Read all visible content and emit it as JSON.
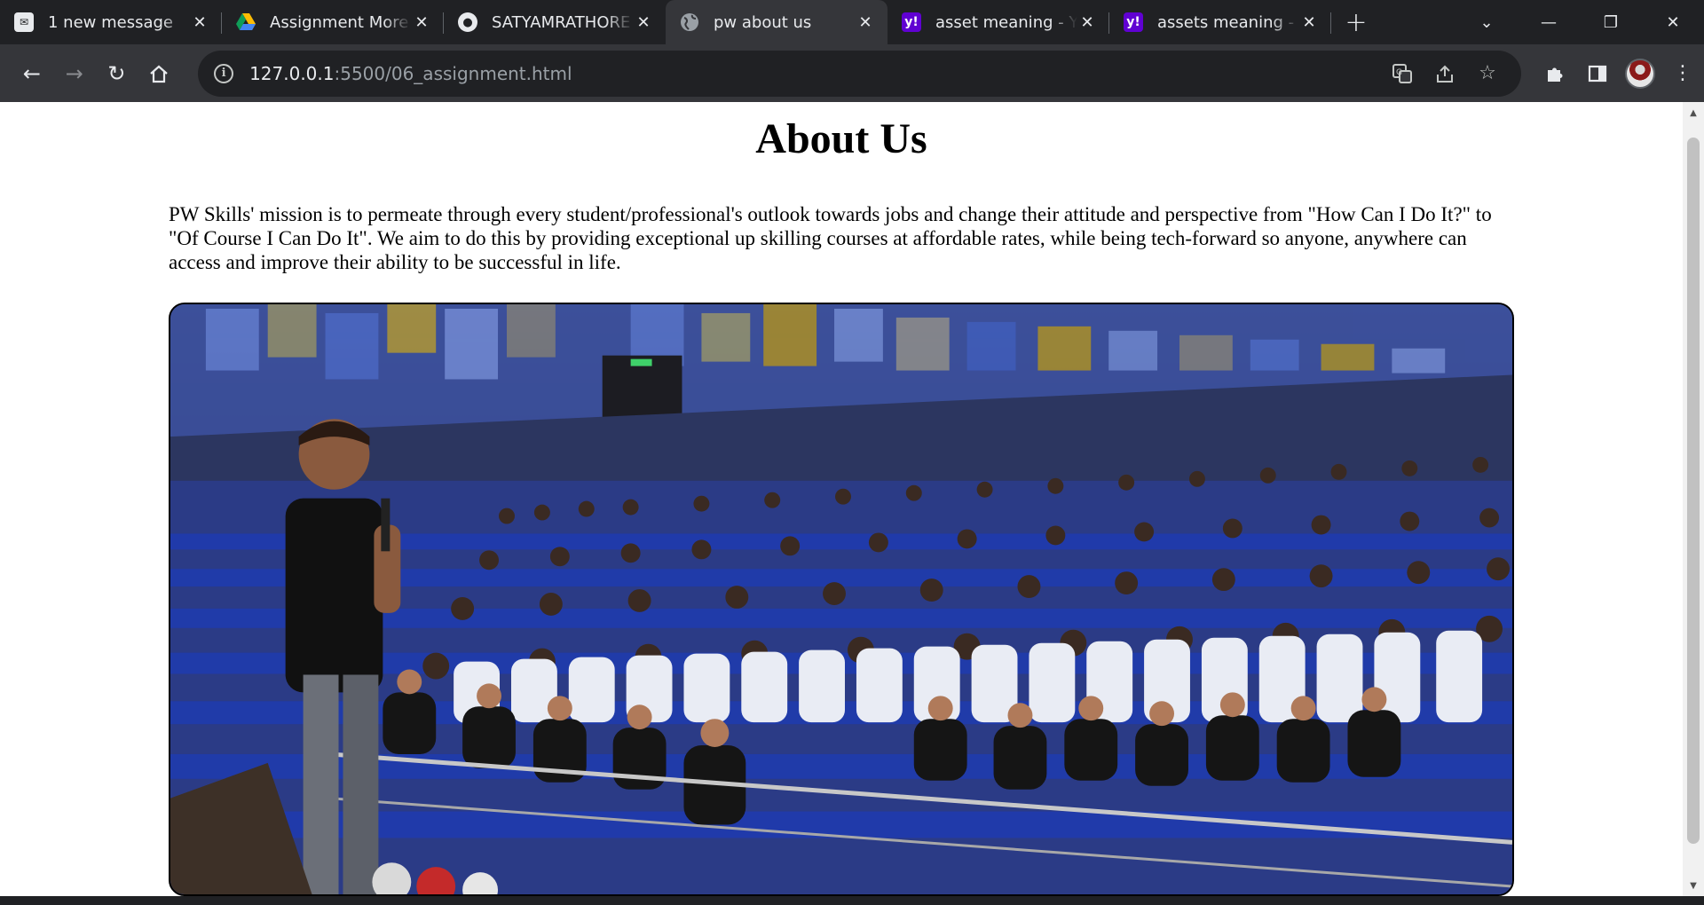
{
  "browser": {
    "tabs": [
      {
        "title": "1 new message",
        "favicon": "mail-favicon-icon",
        "active": false
      },
      {
        "title": "Assignment More",
        "favicon": "drive-favicon-icon",
        "active": false
      },
      {
        "title": "SATYAMRATHORE",
        "favicon": "github-favicon-icon",
        "active": false
      },
      {
        "title": "pw about us",
        "favicon": "globe-favicon-icon",
        "active": true
      },
      {
        "title": "asset meaning - Ya",
        "favicon": "yahoo-favicon-icon",
        "active": false
      },
      {
        "title": "assets meaning - Y",
        "favicon": "yahoo-favicon-icon",
        "active": false
      }
    ],
    "address": {
      "host": "127.0.0.1",
      "path": ":5500/06_assignment.html"
    },
    "colors": {
      "frame": "#202124",
      "toolbar": "#35363a",
      "yahoo": "#6001d2"
    }
  },
  "page": {
    "title": "About Us",
    "mission": "PW Skills' mission is to permeate through every student/professional's outlook towards jobs and change their attitude and perspective from \"How Can I Do It?\" to \"Of Course I Can Do It\". We aim to do this by providing exceptional up skilling courses at affordable rates, while being tech-forward so anyone, anywhere can access and improve their ability to be successful in life."
  }
}
